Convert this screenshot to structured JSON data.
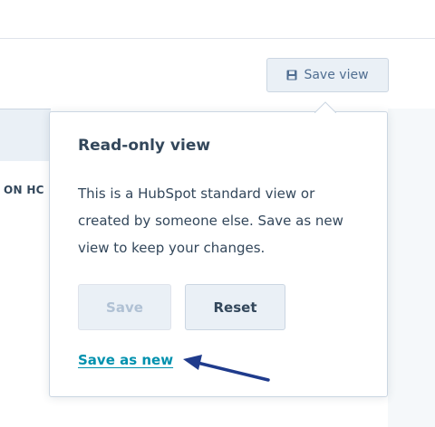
{
  "toolbar": {
    "save_view_label": "Save view",
    "save_view_icon": "floppy-disk-icon"
  },
  "background": {
    "column_header_partial": "ON HC"
  },
  "popover": {
    "title": "Read-only view",
    "body": "This is a HubSpot standard view or created by someone else. Save as new view to keep your changes.",
    "save_label": "Save",
    "reset_label": "Reset",
    "save_as_new_label": "Save as new"
  },
  "annotation": {
    "arrow_color": "#1f3b8c",
    "arrow_icon": "arrow-left-icon"
  },
  "colors": {
    "link": "#0091ae",
    "text": "#33475b",
    "button_bg": "#eaf0f6",
    "border": "#cbd6e2"
  }
}
